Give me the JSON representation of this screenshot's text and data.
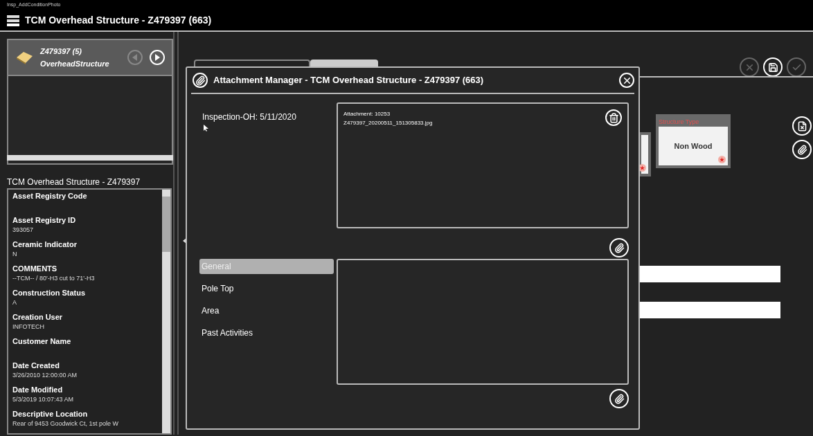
{
  "app_name": "Insp_AddConditionPhoto",
  "window": {
    "title": "TCM Overhead Structure - Z479397 (663)"
  },
  "asset_card": {
    "id": "Z479397 (5)",
    "type": "OverheadStructure",
    "nav": [
      {
        "kind": "prev",
        "disabled": true
      },
      {
        "kind": "next",
        "disabled": false
      }
    ]
  },
  "details": {
    "title": "TCM Overhead Structure - Z479397",
    "fields": [
      {
        "label": "Asset Registry Code"
      },
      {
        "label": "Asset Registry ID",
        "value": "393057"
      },
      {
        "label": "Ceramic Indicator",
        "value": "N"
      },
      {
        "label": "COMMENTS",
        "value": "--TCM-- / 80'-H3 cut to 71'-H3"
      },
      {
        "label": "Construction Status",
        "value": "A"
      },
      {
        "label": "Creation User",
        "value": "INFOTECH"
      },
      {
        "label": "Customer Name"
      },
      {
        "label": "Date Created",
        "value": "3/26/2010 12:00:00 AM"
      },
      {
        "label": "Date Modified",
        "value": "5/3/2019 10:07:43 AM"
      },
      {
        "label": "Descriptive Location",
        "value": "Rear of 9453 Goodwick Ct, 1st pole W"
      }
    ]
  },
  "tabs": [
    {
      "selected": false
    },
    {
      "selected": true
    }
  ],
  "toolbar": [
    {
      "kind": "cancel",
      "disabled": true
    },
    {
      "kind": "save",
      "disabled": false
    },
    {
      "kind": "approve",
      "disabled": true
    }
  ],
  "cards": [
    {
      "required": true
    },
    {
      "heading": "Structure Type",
      "value": "Non Wood",
      "required": true
    }
  ],
  "dialog": {
    "title": "Attachment Manager - TCM Overhead Structure - Z479397 (663)",
    "inspection": "Inspection-OH: 5/11/2020",
    "attachments": [
      {
        "label": "Attachment: 10253",
        "file": "Z479397_20200511_151305833.jpg"
      }
    ],
    "categories": [
      {
        "label": "General",
        "selected": true
      },
      {
        "label": "Pole Top",
        "selected": false
      },
      {
        "label": "Area",
        "selected": false
      },
      {
        "label": "Past Activities",
        "selected": false
      }
    ]
  }
}
